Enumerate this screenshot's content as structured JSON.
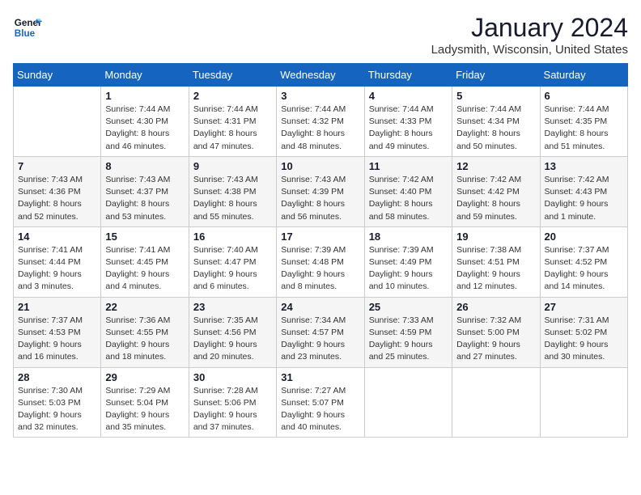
{
  "logo": {
    "line1": "General",
    "line2": "Blue"
  },
  "title": "January 2024",
  "subtitle": "Ladysmith, Wisconsin, United States",
  "weekdays": [
    "Sunday",
    "Monday",
    "Tuesday",
    "Wednesday",
    "Thursday",
    "Friday",
    "Saturday"
  ],
  "weeks": [
    [
      {
        "day": "",
        "info": ""
      },
      {
        "day": "1",
        "info": "Sunrise: 7:44 AM\nSunset: 4:30 PM\nDaylight: 8 hours\nand 46 minutes."
      },
      {
        "day": "2",
        "info": "Sunrise: 7:44 AM\nSunset: 4:31 PM\nDaylight: 8 hours\nand 47 minutes."
      },
      {
        "day": "3",
        "info": "Sunrise: 7:44 AM\nSunset: 4:32 PM\nDaylight: 8 hours\nand 48 minutes."
      },
      {
        "day": "4",
        "info": "Sunrise: 7:44 AM\nSunset: 4:33 PM\nDaylight: 8 hours\nand 49 minutes."
      },
      {
        "day": "5",
        "info": "Sunrise: 7:44 AM\nSunset: 4:34 PM\nDaylight: 8 hours\nand 50 minutes."
      },
      {
        "day": "6",
        "info": "Sunrise: 7:44 AM\nSunset: 4:35 PM\nDaylight: 8 hours\nand 51 minutes."
      }
    ],
    [
      {
        "day": "7",
        "info": "Sunrise: 7:43 AM\nSunset: 4:36 PM\nDaylight: 8 hours\nand 52 minutes."
      },
      {
        "day": "8",
        "info": "Sunrise: 7:43 AM\nSunset: 4:37 PM\nDaylight: 8 hours\nand 53 minutes."
      },
      {
        "day": "9",
        "info": "Sunrise: 7:43 AM\nSunset: 4:38 PM\nDaylight: 8 hours\nand 55 minutes."
      },
      {
        "day": "10",
        "info": "Sunrise: 7:43 AM\nSunset: 4:39 PM\nDaylight: 8 hours\nand 56 minutes."
      },
      {
        "day": "11",
        "info": "Sunrise: 7:42 AM\nSunset: 4:40 PM\nDaylight: 8 hours\nand 58 minutes."
      },
      {
        "day": "12",
        "info": "Sunrise: 7:42 AM\nSunset: 4:42 PM\nDaylight: 8 hours\nand 59 minutes."
      },
      {
        "day": "13",
        "info": "Sunrise: 7:42 AM\nSunset: 4:43 PM\nDaylight: 9 hours\nand 1 minute."
      }
    ],
    [
      {
        "day": "14",
        "info": "Sunrise: 7:41 AM\nSunset: 4:44 PM\nDaylight: 9 hours\nand 3 minutes."
      },
      {
        "day": "15",
        "info": "Sunrise: 7:41 AM\nSunset: 4:45 PM\nDaylight: 9 hours\nand 4 minutes."
      },
      {
        "day": "16",
        "info": "Sunrise: 7:40 AM\nSunset: 4:47 PM\nDaylight: 9 hours\nand 6 minutes."
      },
      {
        "day": "17",
        "info": "Sunrise: 7:39 AM\nSunset: 4:48 PM\nDaylight: 9 hours\nand 8 minutes."
      },
      {
        "day": "18",
        "info": "Sunrise: 7:39 AM\nSunset: 4:49 PM\nDaylight: 9 hours\nand 10 minutes."
      },
      {
        "day": "19",
        "info": "Sunrise: 7:38 AM\nSunset: 4:51 PM\nDaylight: 9 hours\nand 12 minutes."
      },
      {
        "day": "20",
        "info": "Sunrise: 7:37 AM\nSunset: 4:52 PM\nDaylight: 9 hours\nand 14 minutes."
      }
    ],
    [
      {
        "day": "21",
        "info": "Sunrise: 7:37 AM\nSunset: 4:53 PM\nDaylight: 9 hours\nand 16 minutes."
      },
      {
        "day": "22",
        "info": "Sunrise: 7:36 AM\nSunset: 4:55 PM\nDaylight: 9 hours\nand 18 minutes."
      },
      {
        "day": "23",
        "info": "Sunrise: 7:35 AM\nSunset: 4:56 PM\nDaylight: 9 hours\nand 20 minutes."
      },
      {
        "day": "24",
        "info": "Sunrise: 7:34 AM\nSunset: 4:57 PM\nDaylight: 9 hours\nand 23 minutes."
      },
      {
        "day": "25",
        "info": "Sunrise: 7:33 AM\nSunset: 4:59 PM\nDaylight: 9 hours\nand 25 minutes."
      },
      {
        "day": "26",
        "info": "Sunrise: 7:32 AM\nSunset: 5:00 PM\nDaylight: 9 hours\nand 27 minutes."
      },
      {
        "day": "27",
        "info": "Sunrise: 7:31 AM\nSunset: 5:02 PM\nDaylight: 9 hours\nand 30 minutes."
      }
    ],
    [
      {
        "day": "28",
        "info": "Sunrise: 7:30 AM\nSunset: 5:03 PM\nDaylight: 9 hours\nand 32 minutes."
      },
      {
        "day": "29",
        "info": "Sunrise: 7:29 AM\nSunset: 5:04 PM\nDaylight: 9 hours\nand 35 minutes."
      },
      {
        "day": "30",
        "info": "Sunrise: 7:28 AM\nSunset: 5:06 PM\nDaylight: 9 hours\nand 37 minutes."
      },
      {
        "day": "31",
        "info": "Sunrise: 7:27 AM\nSunset: 5:07 PM\nDaylight: 9 hours\nand 40 minutes."
      },
      {
        "day": "",
        "info": ""
      },
      {
        "day": "",
        "info": ""
      },
      {
        "day": "",
        "info": ""
      }
    ]
  ]
}
